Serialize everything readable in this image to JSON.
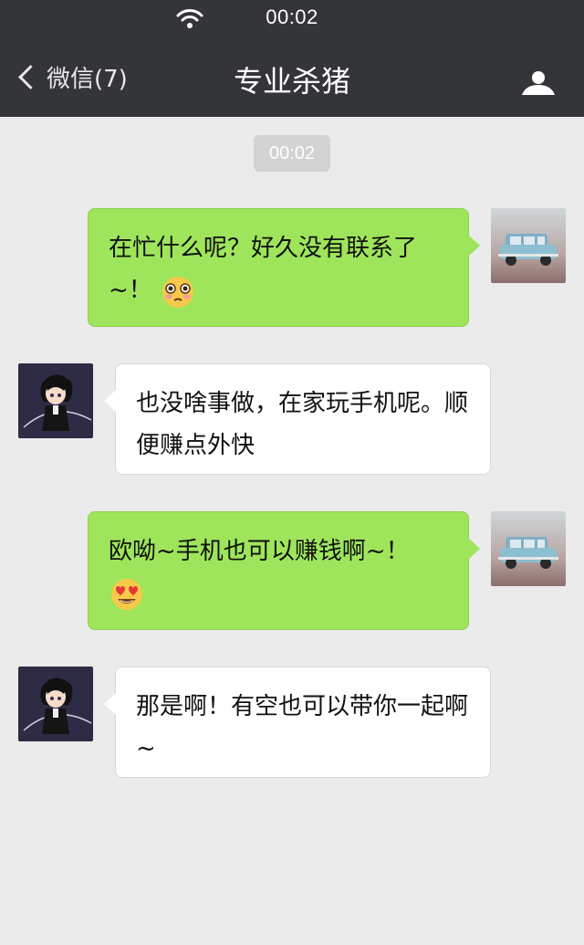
{
  "status_bar": {
    "time": "00:02",
    "wifi_icon": "wifi-icon"
  },
  "header": {
    "back_label": "微信(7)",
    "title": "专业杀猪",
    "profile_icon": "person-icon"
  },
  "chat": {
    "timestamp": "00:02",
    "messages": [
      {
        "side": "sent",
        "text": "在忙什么呢？好久没有联系了~！",
        "emoji": "shy-blush-emoji"
      },
      {
        "side": "received",
        "text": "也没啥事做，在家玩手机呢。顺便赚点外快"
      },
      {
        "side": "sent",
        "text": "欧呦~手机也可以赚钱啊~！",
        "emoji": "heart-eyes-emoji"
      },
      {
        "side": "received",
        "text": "那是啊！有空也可以带你一起啊~"
      }
    ]
  },
  "colors": {
    "header_bg": "#333539",
    "chat_bg": "#ebebeb",
    "sent_bubble": "#9ee55b",
    "received_bubble": "#ffffff"
  }
}
